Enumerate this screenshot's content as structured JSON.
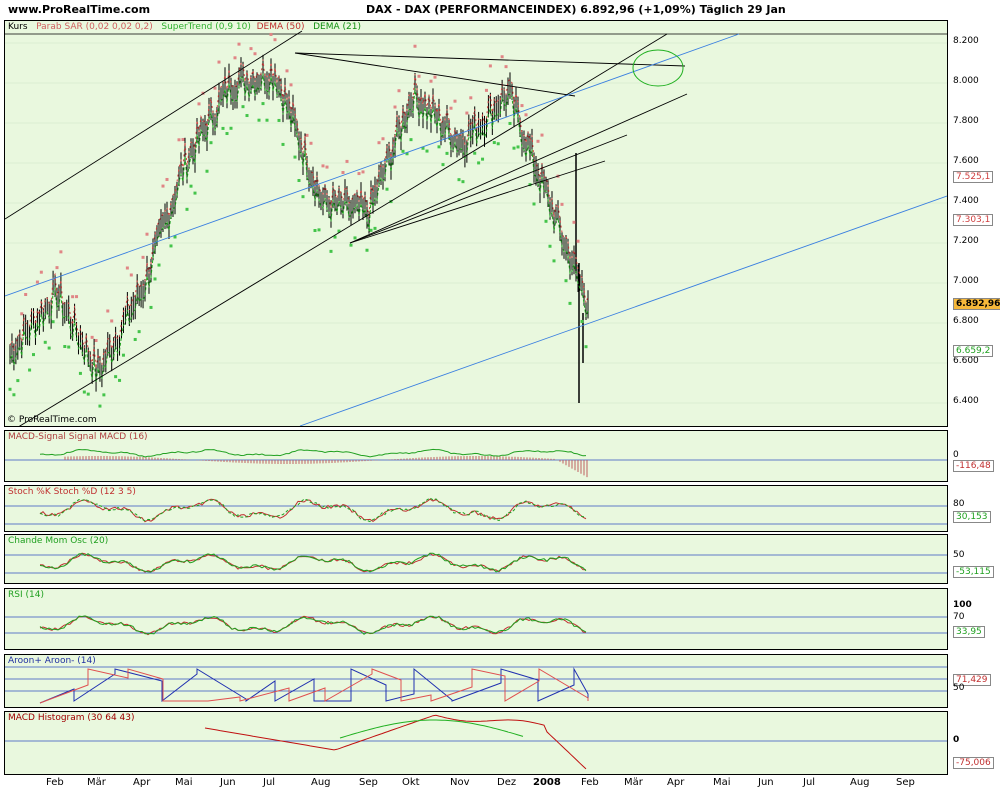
{
  "header": {
    "site": "www.ProRealTime.com",
    "title": "DAX - DAX (PERFORMANCEINDEX)    6.892,96 (+1,09%)    Täglich  29 Jan"
  },
  "main": {
    "legend_kurs": "Kurs",
    "legend_sar": "Parab SAR (0,02 0,02 0,2)",
    "legend_st": "SuperTrend (0,9 10)",
    "legend_dema50": "DEMA (50)",
    "legend_dema21": "DEMA (21)",
    "copyright": "© ProRealTime.com",
    "yticks": [
      "8.200",
      "8.000",
      "7.800",
      "7.600",
      "7.400",
      "7.200",
      "7.000",
      "6.800",
      "6.600",
      "6.400"
    ],
    "boxes": [
      {
        "label": "7.525,1",
        "color": "#d04040"
      },
      {
        "label": "7.303,1",
        "color": "#d04040"
      },
      {
        "label": "6.892,96",
        "color": "#000000"
      },
      {
        "label": "6.659,2",
        "color": "#20a020"
      }
    ]
  },
  "panels": {
    "macd": {
      "title": "MACD-Signal Signal MACD (16)",
      "value": "-116,48",
      "tick": "0"
    },
    "stoch": {
      "title": "Stoch %K Stoch %D (12 3 5)",
      "value": "30,153",
      "tick": "80"
    },
    "chande": {
      "title": "Chande Mom Osc (20)",
      "value": "-53,115",
      "tick": "50"
    },
    "rsi": {
      "title": "RSI (14)",
      "value": "33,95",
      "tick1": "100",
      "tick2": "70"
    },
    "aroon": {
      "title": "Aroon+ Aroon- (14)",
      "value": "71,429",
      "tick": "50"
    },
    "hist": {
      "title": "MACD Histogram (30 64 43)",
      "value": "-75,006",
      "tick": "0"
    }
  },
  "xaxis": [
    "Feb",
    "Mär",
    "Apr",
    "Mai",
    "Jun",
    "Jul",
    "Aug",
    "Sep",
    "Okt",
    "Nov",
    "Dez",
    "2008",
    "Feb",
    "Mär",
    "Apr",
    "Mai",
    "Jun",
    "Jul",
    "Aug",
    "Sep"
  ],
  "chart_data": {
    "type": "line",
    "title": "DAX - DAX (PERFORMANCEINDEX)",
    "ylim": [
      6300,
      8250
    ],
    "x": [
      "2007-01",
      "2007-02",
      "2007-03",
      "2007-04",
      "2007-05",
      "2007-06",
      "2007-07",
      "2007-08",
      "2007-09",
      "2007-10",
      "2007-11",
      "2007-12",
      "2008-01"
    ],
    "series": [
      {
        "name": "Kurs",
        "values": [
          6650,
          6950,
          6550,
          7000,
          7600,
          8000,
          8050,
          7400,
          7350,
          7950,
          7700,
          7950,
          6892.96
        ]
      }
    ],
    "colors": {
      "price": "#000000",
      "sar": "#e08080",
      "supertrend": "#40c040",
      "dema50": "#d04040",
      "dema21": "#20a020",
      "trend": "#3a7fe0"
    }
  }
}
